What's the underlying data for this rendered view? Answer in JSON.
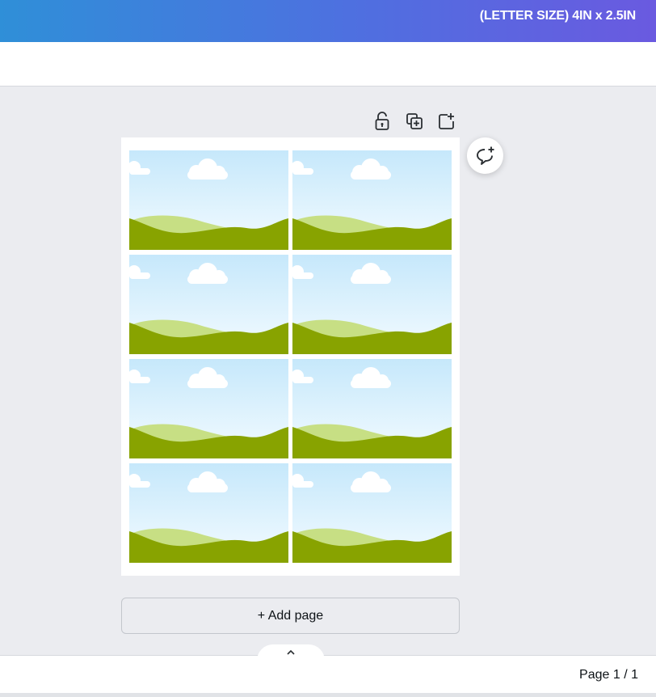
{
  "header": {
    "title": "(LETTER SIZE) 4IN x 2.5IN",
    "gradient_start": "#2f8fd8",
    "gradient_end": "#6a5ae0"
  },
  "page_tools": [
    {
      "icon": "lock-open-icon"
    },
    {
      "icon": "duplicate-page-icon"
    },
    {
      "icon": "add-page-icon"
    }
  ],
  "comment_button": {
    "icon": "add-comment-icon"
  },
  "canvas": {
    "cards": [
      {
        "art": "sky-cloud-hills"
      },
      {
        "art": "sky-cloud-hills"
      },
      {
        "art": "sky-cloud-hills"
      },
      {
        "art": "sky-cloud-hills"
      },
      {
        "art": "sky-cloud-hills"
      },
      {
        "art": "sky-cloud-hills"
      },
      {
        "art": "sky-cloud-hills"
      },
      {
        "art": "sky-cloud-hills"
      }
    ],
    "colors": {
      "sky_top": "#c6e8fb",
      "sky_bottom": "#f3fbff",
      "hill_light": "#c7df84",
      "hill_dark": "#88a300",
      "cloud": "#ffffff"
    }
  },
  "add_page": {
    "label": "+ Add page"
  },
  "collapse_toggle": {
    "icon": "chevron-up-icon"
  },
  "footer": {
    "page_indicator": "Page 1 / 1"
  }
}
